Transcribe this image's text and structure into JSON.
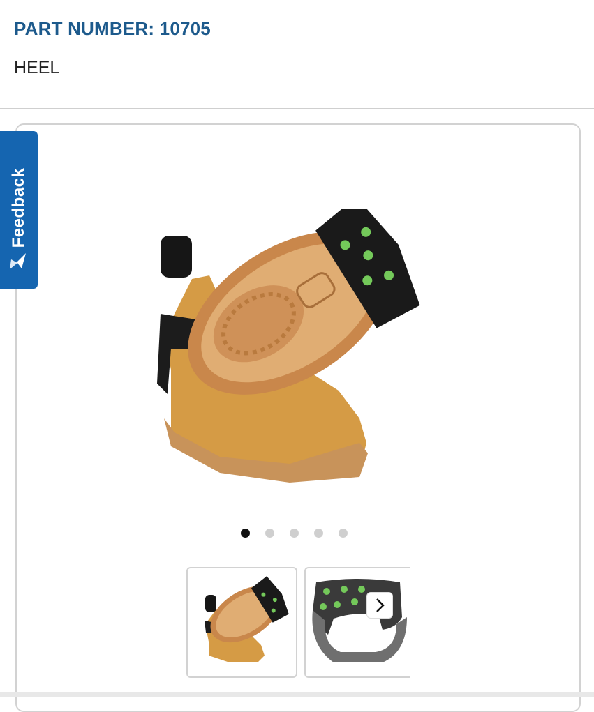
{
  "product": {
    "part_number_label": "PART NUMBER: 10705",
    "name": "HEEL"
  },
  "feedback": {
    "label": "Feedback",
    "icon": "paper-plane-icon",
    "color": "#1565b0"
  },
  "gallery": {
    "main_image_alt": "boots with heel ice cleats",
    "slide_count": 5,
    "active_slide": 1,
    "thumbnails": [
      {
        "alt": "boots with heel ice cleats",
        "selected": true
      },
      {
        "alt": "heel ice cleat"
      }
    ],
    "next_icon": "chevron-right-icon"
  },
  "colors": {
    "title": "#1d5a8c",
    "accent": "#1565b0"
  }
}
